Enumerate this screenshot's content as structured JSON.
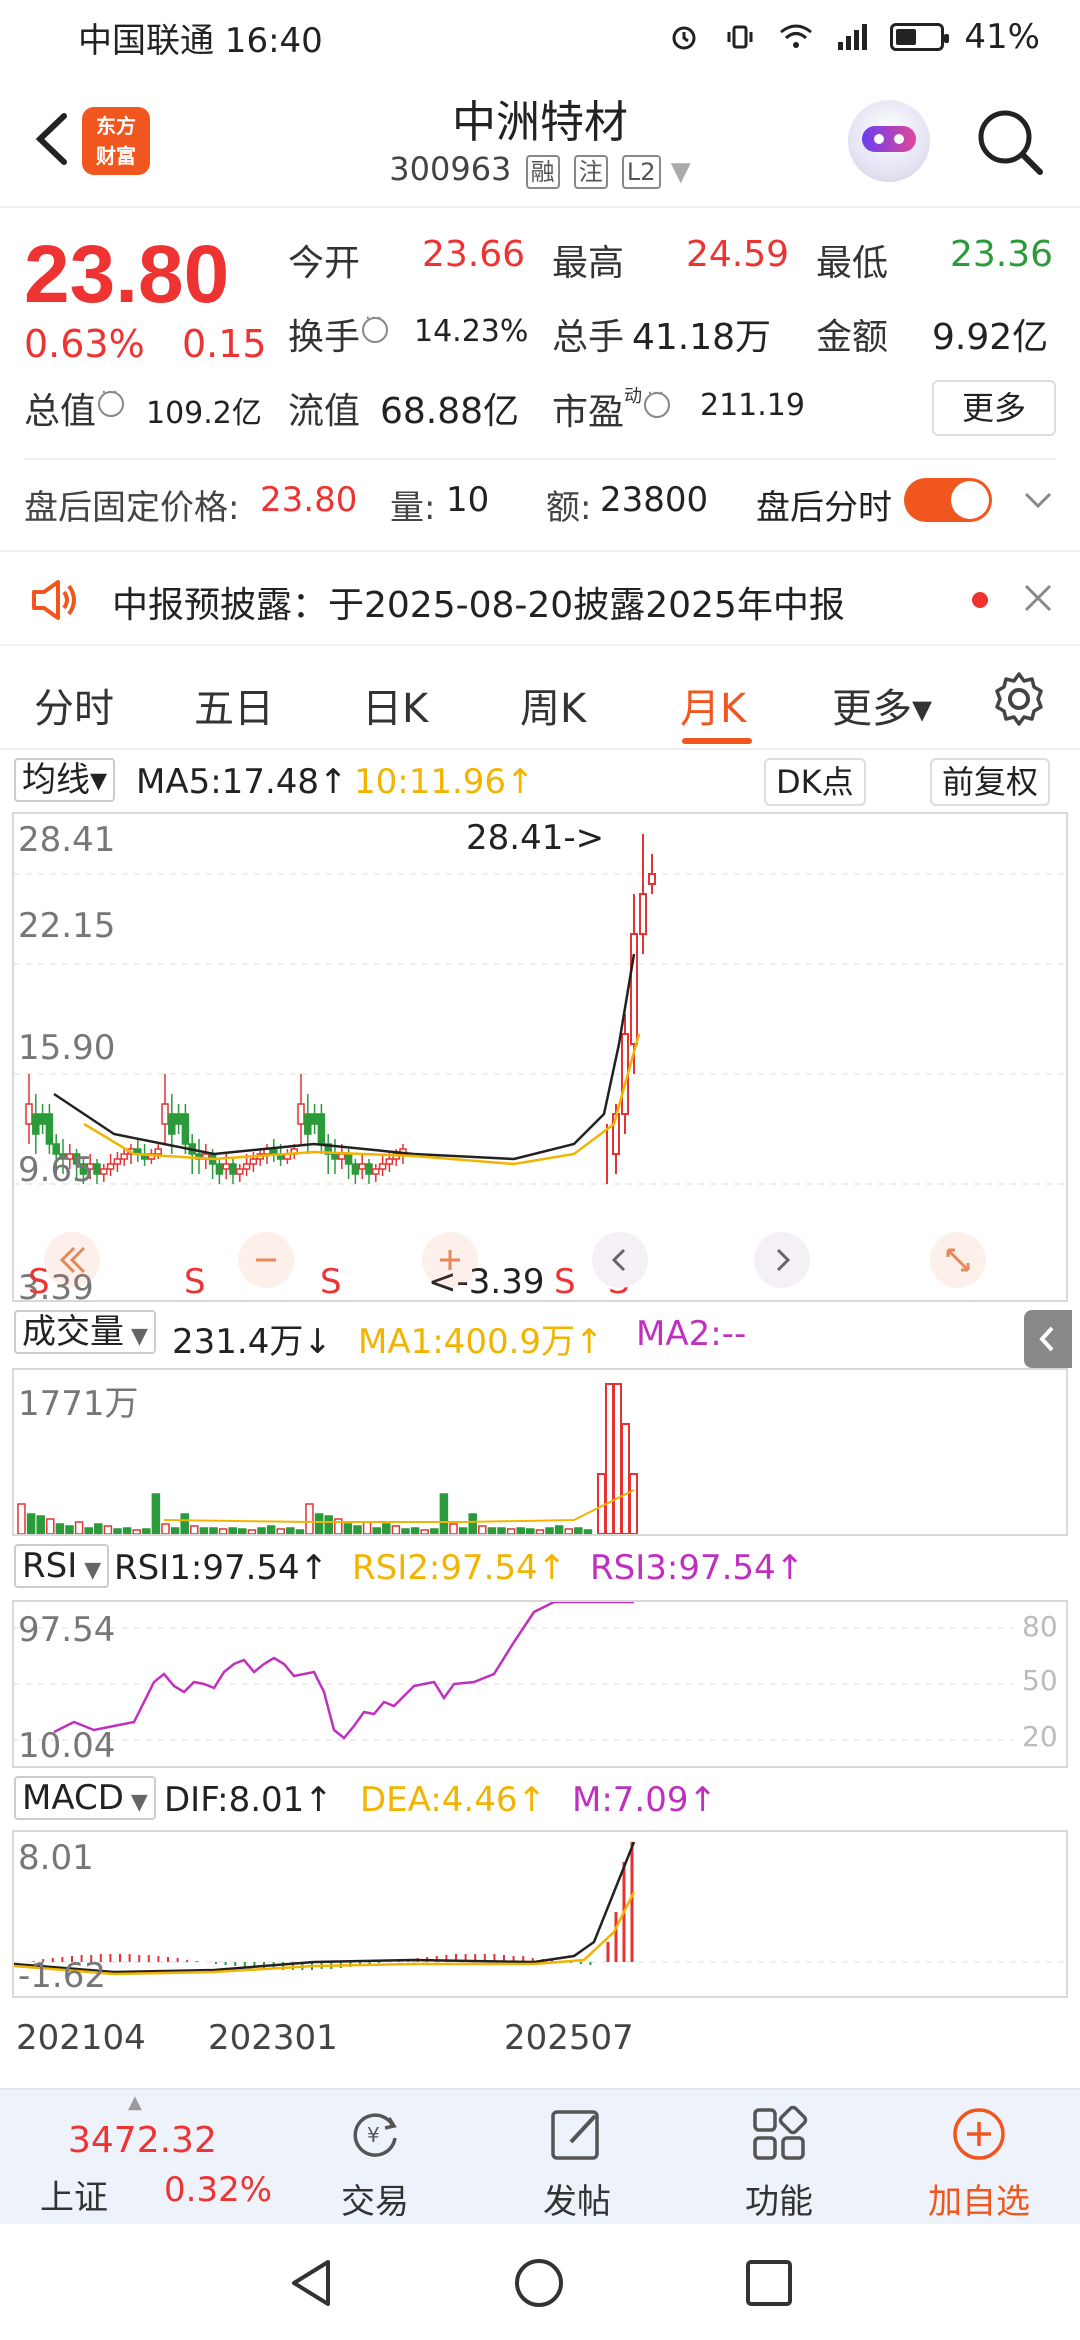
{
  "status_bar": {
    "carrier_time": "中国联通 16:40",
    "battery": "41%"
  },
  "header": {
    "logo_line1": "东方",
    "logo_line2": "财富",
    "name": "中洲特材",
    "code": "300963",
    "tags": [
      "融",
      "注",
      "L2"
    ]
  },
  "quote": {
    "price": "23.80",
    "change_pct": "0.63%",
    "change": "0.15",
    "open_label": "今开",
    "open": "23.66",
    "high_label": "最高",
    "high": "24.59",
    "low_label": "最低",
    "low": "23.36",
    "turnover_label": "换手",
    "turnover": "14.23%",
    "volume_label": "总手",
    "volume": "41.18万",
    "amount_label": "金额",
    "amount": "9.92亿",
    "mktcap_label": "总值",
    "mktcap": "109.2亿",
    "float_label": "流值",
    "float": "68.88亿",
    "pe_label": "市盈",
    "pe_sup": "动",
    "pe": "211.19",
    "more": "更多"
  },
  "after_hours": {
    "price_label": "盘后固定价格:",
    "price": "23.80",
    "vol_label": "量:",
    "vol": "10",
    "amt_label": "额:",
    "amt": "23800",
    "toggle_label": "盘后分时",
    "toggle_on": true
  },
  "notice": {
    "text": "中报预披露：于2025-08-20披露2025年中报"
  },
  "tabs": [
    "分时",
    "五日",
    "日K",
    "周K",
    "月K",
    "更多▾"
  ],
  "active_tab": 4,
  "kline": {
    "indicator": "均线▾",
    "ma5": "MA5:17.48↑",
    "ma10": "10:11.96↑",
    "dk_btn": "DK点",
    "adj_btn": "前复权",
    "y_labels": [
      "28.41",
      "22.15",
      "15.90",
      "9.65",
      "3.39"
    ],
    "high_annot": "28.41->",
    "low_annot": "<-3.39",
    "signal": "S"
  },
  "volume": {
    "indicator": "成交量",
    "value": "231.4万↓",
    "ma1": "MA1:400.9万↑",
    "ma2": "MA2:--",
    "y_label": "1771万"
  },
  "rsi": {
    "indicator": "RSI",
    "rsi1": "RSI1:97.54↑",
    "rsi2": "RSI2:97.54↑",
    "rsi3": "RSI3:97.54↑",
    "y_top": "97.54",
    "y_bottom": "10.04",
    "right_labels": [
      "80",
      "50",
      "20"
    ]
  },
  "macd": {
    "indicator": "MACD",
    "dif": "DIF:8.01↑",
    "dea": "DEA:4.46↑",
    "m": "M:7.09↑",
    "y_top": "8.01",
    "y_bottom": "-1.62"
  },
  "x_axis": [
    "202104",
    "202301",
    "202507"
  ],
  "bottom_nav": {
    "index_value": "3472.32",
    "index_name": "上证",
    "index_pct": "0.32%",
    "items": [
      "交易",
      "发帖",
      "功能",
      "加自选"
    ]
  },
  "colors": {
    "up": "#e33333",
    "down": "#2a9a3a",
    "accent": "#f0561d",
    "ma5": "#222222",
    "ma10": "#f2b400",
    "ma_purple": "#c030c0"
  },
  "chart_data": [
    {
      "type": "candlestick",
      "title": "中洲特材 月K",
      "ylim": [
        3.39,
        28.41
      ],
      "x_ticks": [
        "202104",
        "202301",
        "202507"
      ],
      "series": [
        {
          "name": "MA5",
          "value": 17.48
        },
        {
          "name": "MA10",
          "value": 11.96
        }
      ],
      "annotations": [
        "28.41->",
        "<-3.39"
      ]
    },
    {
      "type": "bar",
      "title": "成交量",
      "ylim": [
        0,
        1771
      ],
      "unit": "万",
      "latest": 231.4,
      "series": [
        {
          "name": "MA1",
          "value": 400.9
        }
      ]
    },
    {
      "type": "line",
      "title": "RSI",
      "ylim": [
        10.04,
        97.54
      ],
      "series": [
        {
          "name": "RSI1",
          "value": 97.54
        },
        {
          "name": "RSI2",
          "value": 97.54
        },
        {
          "name": "RSI3",
          "value": 97.54
        }
      ]
    },
    {
      "type": "line",
      "title": "MACD",
      "ylim": [
        -1.62,
        8.01
      ],
      "series": [
        {
          "name": "DIF",
          "value": 8.01
        },
        {
          "name": "DEA",
          "value": 4.46
        },
        {
          "name": "M",
          "value": 7.09
        }
      ]
    }
  ]
}
